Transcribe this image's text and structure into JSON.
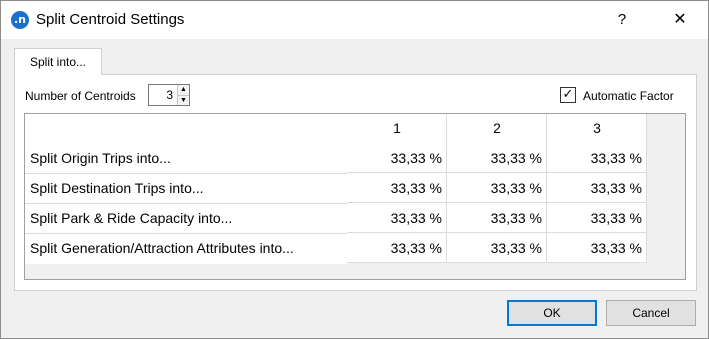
{
  "window": {
    "title": "Split Centroid Settings",
    "app_icon_glyph": ".n",
    "help_label": "?",
    "close_label": "✕"
  },
  "tab": {
    "label": "Split into..."
  },
  "centroids": {
    "label": "Number of Centroids",
    "value": "3"
  },
  "auto_factor": {
    "label": "Automatic Factor",
    "checked": true,
    "check_glyph": "✓"
  },
  "grid": {
    "columns": [
      "1",
      "2",
      "3"
    ],
    "rows": [
      {
        "label": "Split Origin Trips into...",
        "values": [
          "33,33 %",
          "33,33 %",
          "33,33 %"
        ]
      },
      {
        "label": "Split Destination Trips into...",
        "values": [
          "33,33 %",
          "33,33 %",
          "33,33 %"
        ]
      },
      {
        "label": "Split Park & Ride Capacity into...",
        "values": [
          "33,33 %",
          "33,33 %",
          "33,33 %"
        ]
      },
      {
        "label": "Split Generation/Attraction Attributes into...",
        "values": [
          "33,33 %",
          "33,33 %",
          "33,33 %"
        ]
      }
    ]
  },
  "buttons": {
    "ok": "OK",
    "cancel": "Cancel"
  },
  "colors": {
    "accent": "#0078d7",
    "app_icon": "#1a73c9"
  }
}
